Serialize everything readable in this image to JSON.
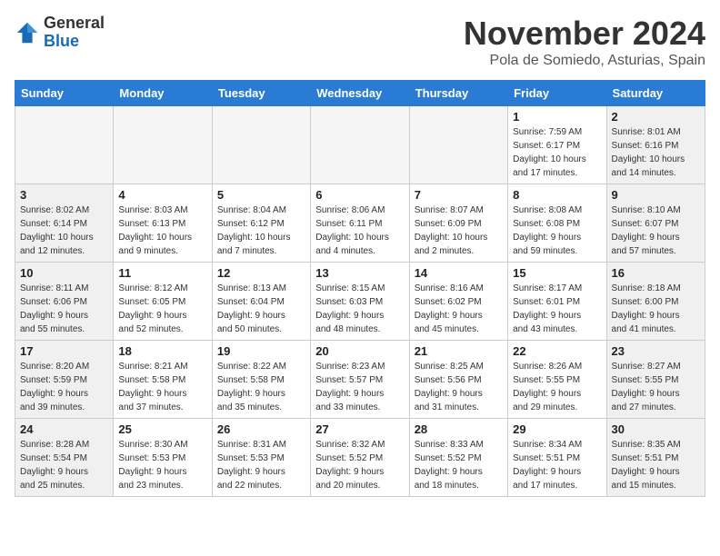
{
  "header": {
    "logo_general": "General",
    "logo_blue": "Blue",
    "month_title": "November 2024",
    "location": "Pola de Somiedo, Asturias, Spain"
  },
  "days_of_week": [
    "Sunday",
    "Monday",
    "Tuesday",
    "Wednesday",
    "Thursday",
    "Friday",
    "Saturday"
  ],
  "weeks": [
    [
      {
        "day": "",
        "info": "",
        "empty": true
      },
      {
        "day": "",
        "info": "",
        "empty": true
      },
      {
        "day": "",
        "info": "",
        "empty": true
      },
      {
        "day": "",
        "info": "",
        "empty": true
      },
      {
        "day": "",
        "info": "",
        "empty": true
      },
      {
        "day": "1",
        "info": "Sunrise: 7:59 AM\nSunset: 6:17 PM\nDaylight: 10 hours\nand 17 minutes."
      },
      {
        "day": "2",
        "info": "Sunrise: 8:01 AM\nSunset: 6:16 PM\nDaylight: 10 hours\nand 14 minutes.",
        "weekend": true
      }
    ],
    [
      {
        "day": "3",
        "info": "Sunrise: 8:02 AM\nSunset: 6:14 PM\nDaylight: 10 hours\nand 12 minutes.",
        "weekend": true
      },
      {
        "day": "4",
        "info": "Sunrise: 8:03 AM\nSunset: 6:13 PM\nDaylight: 10 hours\nand 9 minutes."
      },
      {
        "day": "5",
        "info": "Sunrise: 8:04 AM\nSunset: 6:12 PM\nDaylight: 10 hours\nand 7 minutes."
      },
      {
        "day": "6",
        "info": "Sunrise: 8:06 AM\nSunset: 6:11 PM\nDaylight: 10 hours\nand 4 minutes."
      },
      {
        "day": "7",
        "info": "Sunrise: 8:07 AM\nSunset: 6:09 PM\nDaylight: 10 hours\nand 2 minutes."
      },
      {
        "day": "8",
        "info": "Sunrise: 8:08 AM\nSunset: 6:08 PM\nDaylight: 9 hours\nand 59 minutes."
      },
      {
        "day": "9",
        "info": "Sunrise: 8:10 AM\nSunset: 6:07 PM\nDaylight: 9 hours\nand 57 minutes.",
        "weekend": true
      }
    ],
    [
      {
        "day": "10",
        "info": "Sunrise: 8:11 AM\nSunset: 6:06 PM\nDaylight: 9 hours\nand 55 minutes.",
        "weekend": true
      },
      {
        "day": "11",
        "info": "Sunrise: 8:12 AM\nSunset: 6:05 PM\nDaylight: 9 hours\nand 52 minutes."
      },
      {
        "day": "12",
        "info": "Sunrise: 8:13 AM\nSunset: 6:04 PM\nDaylight: 9 hours\nand 50 minutes."
      },
      {
        "day": "13",
        "info": "Sunrise: 8:15 AM\nSunset: 6:03 PM\nDaylight: 9 hours\nand 48 minutes."
      },
      {
        "day": "14",
        "info": "Sunrise: 8:16 AM\nSunset: 6:02 PM\nDaylight: 9 hours\nand 45 minutes."
      },
      {
        "day": "15",
        "info": "Sunrise: 8:17 AM\nSunset: 6:01 PM\nDaylight: 9 hours\nand 43 minutes."
      },
      {
        "day": "16",
        "info": "Sunrise: 8:18 AM\nSunset: 6:00 PM\nDaylight: 9 hours\nand 41 minutes.",
        "weekend": true
      }
    ],
    [
      {
        "day": "17",
        "info": "Sunrise: 8:20 AM\nSunset: 5:59 PM\nDaylight: 9 hours\nand 39 minutes.",
        "weekend": true
      },
      {
        "day": "18",
        "info": "Sunrise: 8:21 AM\nSunset: 5:58 PM\nDaylight: 9 hours\nand 37 minutes."
      },
      {
        "day": "19",
        "info": "Sunrise: 8:22 AM\nSunset: 5:58 PM\nDaylight: 9 hours\nand 35 minutes."
      },
      {
        "day": "20",
        "info": "Sunrise: 8:23 AM\nSunset: 5:57 PM\nDaylight: 9 hours\nand 33 minutes."
      },
      {
        "day": "21",
        "info": "Sunrise: 8:25 AM\nSunset: 5:56 PM\nDaylight: 9 hours\nand 31 minutes."
      },
      {
        "day": "22",
        "info": "Sunrise: 8:26 AM\nSunset: 5:55 PM\nDaylight: 9 hours\nand 29 minutes."
      },
      {
        "day": "23",
        "info": "Sunrise: 8:27 AM\nSunset: 5:55 PM\nDaylight: 9 hours\nand 27 minutes.",
        "weekend": true
      }
    ],
    [
      {
        "day": "24",
        "info": "Sunrise: 8:28 AM\nSunset: 5:54 PM\nDaylight: 9 hours\nand 25 minutes.",
        "weekend": true
      },
      {
        "day": "25",
        "info": "Sunrise: 8:30 AM\nSunset: 5:53 PM\nDaylight: 9 hours\nand 23 minutes."
      },
      {
        "day": "26",
        "info": "Sunrise: 8:31 AM\nSunset: 5:53 PM\nDaylight: 9 hours\nand 22 minutes."
      },
      {
        "day": "27",
        "info": "Sunrise: 8:32 AM\nSunset: 5:52 PM\nDaylight: 9 hours\nand 20 minutes."
      },
      {
        "day": "28",
        "info": "Sunrise: 8:33 AM\nSunset: 5:52 PM\nDaylight: 9 hours\nand 18 minutes."
      },
      {
        "day": "29",
        "info": "Sunrise: 8:34 AM\nSunset: 5:51 PM\nDaylight: 9 hours\nand 17 minutes."
      },
      {
        "day": "30",
        "info": "Sunrise: 8:35 AM\nSunset: 5:51 PM\nDaylight: 9 hours\nand 15 minutes.",
        "weekend": true
      }
    ]
  ]
}
